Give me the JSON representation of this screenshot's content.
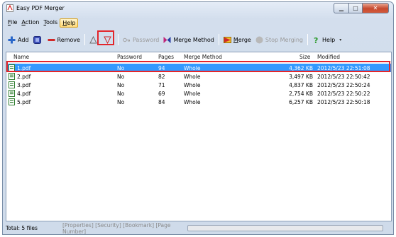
{
  "window": {
    "title": "Easy PDF Merger"
  },
  "menu": [
    {
      "label": "File"
    },
    {
      "label": "Action"
    },
    {
      "label": "Tools"
    },
    {
      "label": "Help"
    }
  ],
  "toolbar": {
    "add": "Add",
    "remove": "Remove",
    "password": "Password",
    "merge_method": "Merge Method",
    "merge": "Merge",
    "stop_merging": "Stop Merging",
    "help": "Help"
  },
  "columns": {
    "name": "Name",
    "password": "Password",
    "pages": "Pages",
    "merge_method": "Merge Method",
    "size": "Size",
    "modified": "Modified"
  },
  "files": [
    {
      "name": "1.pdf",
      "password": "No",
      "pages": "94",
      "merge_method": "Whole",
      "size": "4,362 KB",
      "modified": "2012/5/23 22:51:08"
    },
    {
      "name": "2.pdf",
      "password": "No",
      "pages": "82",
      "merge_method": "Whole",
      "size": "3,497 KB",
      "modified": "2012/5/23 22:50:42"
    },
    {
      "name": "3.pdf",
      "password": "No",
      "pages": "71",
      "merge_method": "Whole",
      "size": "4,837 KB",
      "modified": "2012/5/23 22:50:24"
    },
    {
      "name": "4.pdf",
      "password": "No",
      "pages": "69",
      "merge_method": "Whole",
      "size": "2,754 KB",
      "modified": "2012/5/23 22:50:22"
    },
    {
      "name": "5.pdf",
      "password": "No",
      "pages": "84",
      "merge_method": "Whole",
      "size": "6,257 KB",
      "modified": "2012/5/23 22:50:18"
    }
  ],
  "selected_index": 0,
  "status": {
    "total": "Total: 5 files",
    "links": "[Properties] [Security] [Bookmark] [Page Number]"
  },
  "colors": {
    "selection": "#3399ff",
    "annotation": "#e3252b"
  }
}
